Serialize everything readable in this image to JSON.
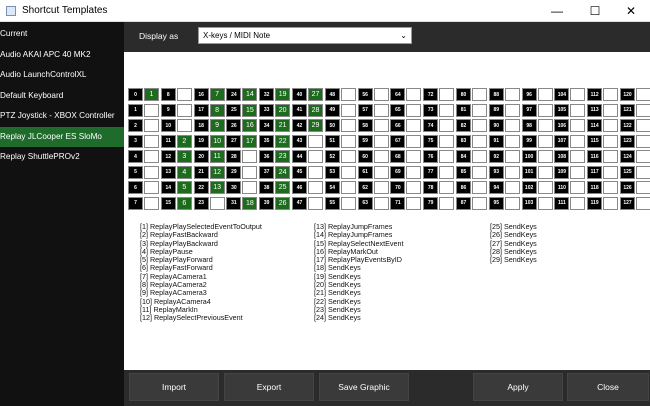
{
  "window": {
    "title": "Shortcut Templates"
  },
  "sidebar": {
    "items": [
      {
        "label": "Current"
      },
      {
        "label": "Audio AKAI APC 40 MK2"
      },
      {
        "label": "Audio LaunchControlXL"
      },
      {
        "label": "Default Keyboard"
      },
      {
        "label": "PTZ Joystick - XBOX Controller"
      },
      {
        "label": "Replay JLCooper ES SloMo"
      },
      {
        "label": "Replay ShuttlePROv2"
      }
    ]
  },
  "display": {
    "label": "Display as",
    "value": "X-keys / MIDI Note"
  },
  "grid": {
    "columns": [
      [
        "0",
        "1",
        "2",
        "3",
        "4",
        "5",
        "6",
        "7"
      ],
      [
        "8",
        "9",
        "10",
        "11",
        "12",
        "13",
        "14",
        "15"
      ],
      [
        "16",
        "17",
        "18",
        "19",
        "20",
        "21",
        "22",
        "23"
      ],
      [
        "24",
        "25",
        "26",
        "27",
        "28",
        "29",
        "30",
        "31"
      ],
      [
        "32",
        "33",
        "34",
        "35",
        "36",
        "37",
        "38",
        "39"
      ],
      [
        "40",
        "41",
        "42",
        "43",
        "44",
        "45",
        "46",
        "47"
      ],
      [
        "48",
        "49",
        "50",
        "51",
        "52",
        "53",
        "54",
        "55"
      ],
      [
        "56",
        "57",
        "58",
        "59",
        "60",
        "61",
        "62",
        "63"
      ],
      [
        "64",
        "65",
        "66",
        "67",
        "68",
        "69",
        "70",
        "71"
      ],
      [
        "72",
        "73",
        "74",
        "75",
        "76",
        "77",
        "78",
        "79"
      ],
      [
        "80",
        "81",
        "82",
        "83",
        "84",
        "85",
        "86",
        "87"
      ],
      [
        "88",
        "89",
        "90",
        "91",
        "92",
        "93",
        "94",
        "95"
      ],
      [
        "96",
        "97",
        "98",
        "99",
        "100",
        "101",
        "102",
        "103"
      ],
      [
        "104",
        "105",
        "106",
        "107",
        "108",
        "109",
        "110",
        "111"
      ],
      [
        "112",
        "113",
        "114",
        "115",
        "116",
        "117",
        "118",
        "119"
      ],
      [
        "120",
        "121",
        "122",
        "123",
        "124",
        "125",
        "126",
        "127"
      ]
    ],
    "assigned": {
      "1": "1",
      "2": "2",
      "3": "3",
      "4": "4",
      "5": "5",
      "6": "6",
      "7": "7",
      "8": "8",
      "9": "9",
      "10": "10",
      "11": "11",
      "12": "12",
      "13": "13",
      "14": "14",
      "15": "15",
      "16": "16",
      "17": "17",
      "18": "18",
      "19": "19",
      "20": "20",
      "21": "21",
      "22": "22",
      "23": "23",
      "24": "24",
      "25": "25",
      "26": "26",
      "27": "27",
      "28": "28",
      "29": "29"
    },
    "assigned_cells": [
      {
        "col": 0,
        "row": 0,
        "n": "1"
      },
      {
        "col": 1,
        "row": 3,
        "n": "2"
      },
      {
        "col": 1,
        "row": 4,
        "n": "3"
      },
      {
        "col": 1,
        "row": 5,
        "n": "4"
      },
      {
        "col": 1,
        "row": 6,
        "n": "5"
      },
      {
        "col": 1,
        "row": 7,
        "n": "6"
      },
      {
        "col": 2,
        "row": 0,
        "n": "7"
      },
      {
        "col": 2,
        "row": 1,
        "n": "8"
      },
      {
        "col": 2,
        "row": 2,
        "n": "9"
      },
      {
        "col": 2,
        "row": 3,
        "n": "10"
      },
      {
        "col": 2,
        "row": 4,
        "n": "11"
      },
      {
        "col": 2,
        "row": 5,
        "n": "12"
      },
      {
        "col": 2,
        "row": 6,
        "n": "13"
      },
      {
        "col": 3,
        "row": 0,
        "n": "14"
      },
      {
        "col": 3,
        "row": 1,
        "n": "15"
      },
      {
        "col": 3,
        "row": 2,
        "n": "16"
      },
      {
        "col": 3,
        "row": 3,
        "n": "17"
      },
      {
        "col": 3,
        "row": 7,
        "n": "18"
      },
      {
        "col": 4,
        "row": 0,
        "n": "19"
      },
      {
        "col": 4,
        "row": 1,
        "n": "20"
      },
      {
        "col": 4,
        "row": 2,
        "n": "21"
      },
      {
        "col": 4,
        "row": 3,
        "n": "22"
      },
      {
        "col": 4,
        "row": 4,
        "n": "23"
      },
      {
        "col": 4,
        "row": 5,
        "n": "24"
      },
      {
        "col": 4,
        "row": 6,
        "n": "25"
      },
      {
        "col": 4,
        "row": 7,
        "n": "26"
      },
      {
        "col": 5,
        "row": 0,
        "n": "27"
      },
      {
        "col": 5,
        "row": 1,
        "n": "28"
      },
      {
        "col": 5,
        "row": 2,
        "n": "29"
      }
    ]
  },
  "legend": {
    "col1": [
      "[1] ReplayPlaySelectedEventToOutput",
      "[2] ReplayFastBackward",
      "[3] ReplayPlayBackward",
      "[4] ReplayPause",
      "[5] ReplayPlayForward",
      "[6] ReplayFastForward",
      "[7] ReplayACamera1",
      "[8] ReplayACamera2",
      "[9] ReplayACamera3",
      "[10] ReplayACamera4",
      "[11] ReplayMarkIn",
      "[12] ReplaySelectPreviousEvent"
    ],
    "col2": [
      "[13] ReplayJumpFrames",
      "[14] ReplayJumpFrames",
      "[15] ReplaySelectNextEvent",
      "[16] ReplayMarkOut",
      "[17] ReplayPlayEventsByID",
      "[18] SendKeys",
      "[19] SendKeys",
      "[20] SendKeys",
      "[21] SendKeys",
      "[22] SendKeys",
      "[23] SendKeys",
      "[24] SendKeys"
    ],
    "col3": [
      "[25] SendKeys",
      "[26] SendKeys",
      "[27] SendKeys",
      "[28] SendKeys",
      "[29] SendKeys"
    ]
  },
  "buttons": {
    "import": "Import",
    "export": "Export",
    "save_graphic": "Save Graphic",
    "apply": "Apply",
    "close": "Close"
  },
  "colors": {
    "active": "#1f6b2b",
    "assigned": "#1d6b1d",
    "sidebar": "#111111",
    "panel": "#2b2b2b"
  }
}
